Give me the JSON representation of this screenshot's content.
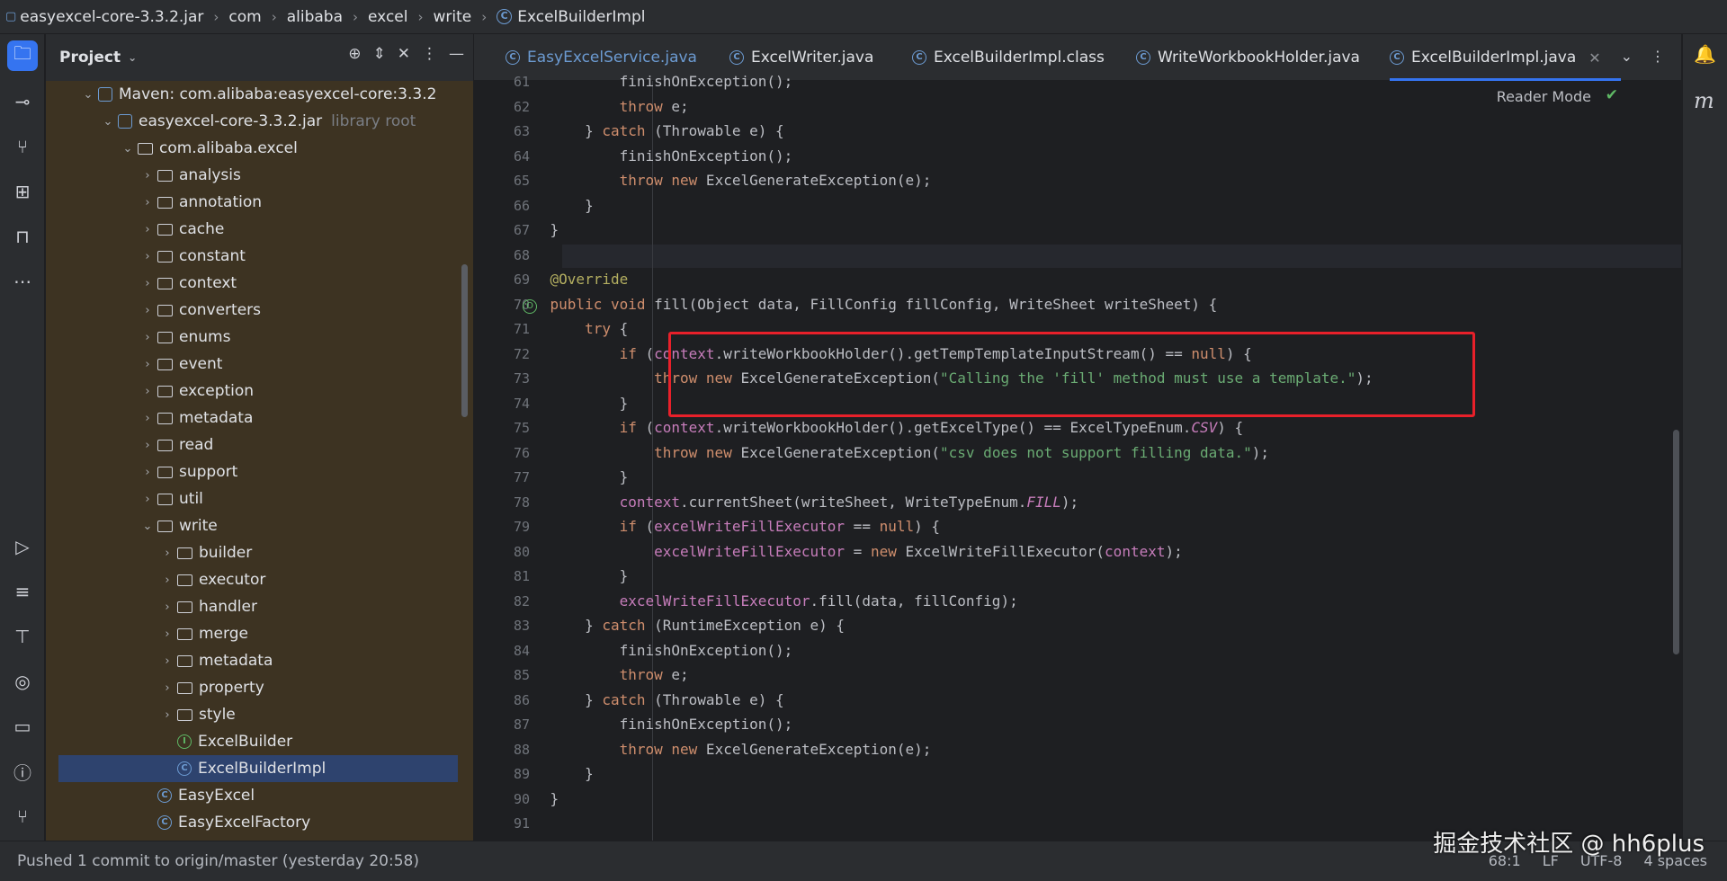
{
  "breadcrumb": [
    "easyexcel-core-3.3.2.jar",
    "com",
    "alibaba",
    "excel",
    "write",
    "ExcelBuilderImpl"
  ],
  "project": {
    "title": "Project",
    "tree": [
      {
        "label": "Maven: com.alibaba:easyexcel-core:3.3.2",
        "depth": 1,
        "kind": "maven",
        "expanded": true
      },
      {
        "label": "easyexcel-core-3.3.2.jar",
        "hint": "library root",
        "depth": 2,
        "kind": "jar",
        "expanded": true
      },
      {
        "label": "com.alibaba.excel",
        "depth": 3,
        "kind": "folder",
        "expanded": true
      },
      {
        "label": "analysis",
        "depth": 4,
        "kind": "folder"
      },
      {
        "label": "annotation",
        "depth": 4,
        "kind": "folder"
      },
      {
        "label": "cache",
        "depth": 4,
        "kind": "folder"
      },
      {
        "label": "constant",
        "depth": 4,
        "kind": "folder"
      },
      {
        "label": "context",
        "depth": 4,
        "kind": "folder"
      },
      {
        "label": "converters",
        "depth": 4,
        "kind": "folder"
      },
      {
        "label": "enums",
        "depth": 4,
        "kind": "folder"
      },
      {
        "label": "event",
        "depth": 4,
        "kind": "folder"
      },
      {
        "label": "exception",
        "depth": 4,
        "kind": "folder"
      },
      {
        "label": "metadata",
        "depth": 4,
        "kind": "folder"
      },
      {
        "label": "read",
        "depth": 4,
        "kind": "folder"
      },
      {
        "label": "support",
        "depth": 4,
        "kind": "folder"
      },
      {
        "label": "util",
        "depth": 4,
        "kind": "folder"
      },
      {
        "label": "write",
        "depth": 4,
        "kind": "folder",
        "expanded": true
      },
      {
        "label": "builder",
        "depth": 5,
        "kind": "folder"
      },
      {
        "label": "executor",
        "depth": 5,
        "kind": "folder"
      },
      {
        "label": "handler",
        "depth": 5,
        "kind": "folder"
      },
      {
        "label": "merge",
        "depth": 5,
        "kind": "folder"
      },
      {
        "label": "metadata",
        "depth": 5,
        "kind": "folder"
      },
      {
        "label": "property",
        "depth": 5,
        "kind": "folder"
      },
      {
        "label": "style",
        "depth": 5,
        "kind": "folder"
      },
      {
        "label": "ExcelBuilder",
        "depth": 5,
        "kind": "interface"
      },
      {
        "label": "ExcelBuilderImpl",
        "depth": 5,
        "kind": "class",
        "selected": true
      },
      {
        "label": "EasyExcel",
        "depth": 4,
        "kind": "class"
      },
      {
        "label": "EasyExcelFactory",
        "depth": 4,
        "kind": "class"
      }
    ]
  },
  "tabs": [
    {
      "label": "EasyExcelService.java"
    },
    {
      "label": "ExcelWriter.java"
    },
    {
      "label": "ExcelBuilderImpl.class"
    },
    {
      "label": "WriteWorkbookHolder.java"
    },
    {
      "label": "ExcelBuilderImpl.java",
      "active": true
    }
  ],
  "editor": {
    "reader_mode": "Reader Mode",
    "lines": [
      {
        "n": "61",
        "html": "            finishOnException();"
      },
      {
        "n": "62",
        "html": "            <span class='kw'>throw</span> e;"
      },
      {
        "n": "63",
        "html": "        } <span class='kw'>catch</span> (Throwable e) {"
      },
      {
        "n": "64",
        "html": "            finishOnException();"
      },
      {
        "n": "65",
        "html": "            <span class='kw'>throw new</span> ExcelGenerateException(e);"
      },
      {
        "n": "66",
        "html": "        }"
      },
      {
        "n": "67",
        "html": "    }"
      },
      {
        "n": "68",
        "html": ""
      },
      {
        "n": "69",
        "html": "    <span class='ann'>@Override</span>"
      },
      {
        "n": "70",
        "html": "    <span class='kw'>public void</span> fill(Object data, FillConfig fillConfig, WriteSheet writeSheet) {"
      },
      {
        "n": "71",
        "html": "        <span class='kw'>try</span> {"
      },
      {
        "n": "72",
        "html": "            <span class='kw'>if</span> (<span class='fld'>context</span>.writeWorkbookHolder().getTempTemplateInputStream() == <span class='kw'>null</span>) {"
      },
      {
        "n": "73",
        "html": "                <span class='kw'>throw new</span> ExcelGenerateException(<span class='str'>\"Calling the 'fill' method must use a template.\"</span>);"
      },
      {
        "n": "74",
        "html": "            }"
      },
      {
        "n": "75",
        "html": "            <span class='kw'>if</span> (<span class='fld'>context</span>.writeWorkbookHolder().getExcelType() == ExcelTypeEnum.<span class='ital'>CSV</span>) {"
      },
      {
        "n": "76",
        "html": "                <span class='kw'>throw new</span> ExcelGenerateException(<span class='str'>\"csv does not support filling data.\"</span>);"
      },
      {
        "n": "77",
        "html": "            }"
      },
      {
        "n": "78",
        "html": "            <span class='fld'>context</span>.currentSheet(writeSheet, WriteTypeEnum.<span class='ital'>FILL</span>);"
      },
      {
        "n": "79",
        "html": "            <span class='kw'>if</span> (<span class='fld'>excelWriteFillExecutor</span> == <span class='kw'>null</span>) {"
      },
      {
        "n": "80",
        "html": "                <span class='fld'>excelWriteFillExecutor</span> = <span class='kw'>new</span> ExcelWriteFillExecutor(<span class='fld'>context</span>);"
      },
      {
        "n": "81",
        "html": "            }"
      },
      {
        "n": "82",
        "html": "            <span class='fld'>excelWriteFillExecutor</span>.fill(data, fillConfig);"
      },
      {
        "n": "83",
        "html": "        } <span class='kw'>catch</span> (RuntimeException e) {"
      },
      {
        "n": "84",
        "html": "            finishOnException();"
      },
      {
        "n": "85",
        "html": "            <span class='kw'>throw</span> e;"
      },
      {
        "n": "86",
        "html": "        } <span class='kw'>catch</span> (Throwable e) {"
      },
      {
        "n": "87",
        "html": "            finishOnException();"
      },
      {
        "n": "88",
        "html": "            <span class='kw'>throw new</span> ExcelGenerateException(e);"
      },
      {
        "n": "89",
        "html": "        }"
      },
      {
        "n": "90",
        "html": "    }"
      },
      {
        "n": "91",
        "html": ""
      }
    ]
  },
  "status": {
    "message": "Pushed 1 commit to origin/master (yesterday 20:58)",
    "position": "68:1",
    "line_sep": "LF",
    "encoding": "UTF-8",
    "indent": "4 spaces"
  },
  "watermark": "掘金技术社区 @ hh6plus",
  "colors": {
    "keyword": "#cf8e6d",
    "string": "#6aab73",
    "annotation": "#b3ae60",
    "field": "#c77dbb",
    "highlight_box": "#e8202a",
    "accent": "#3574f0"
  }
}
